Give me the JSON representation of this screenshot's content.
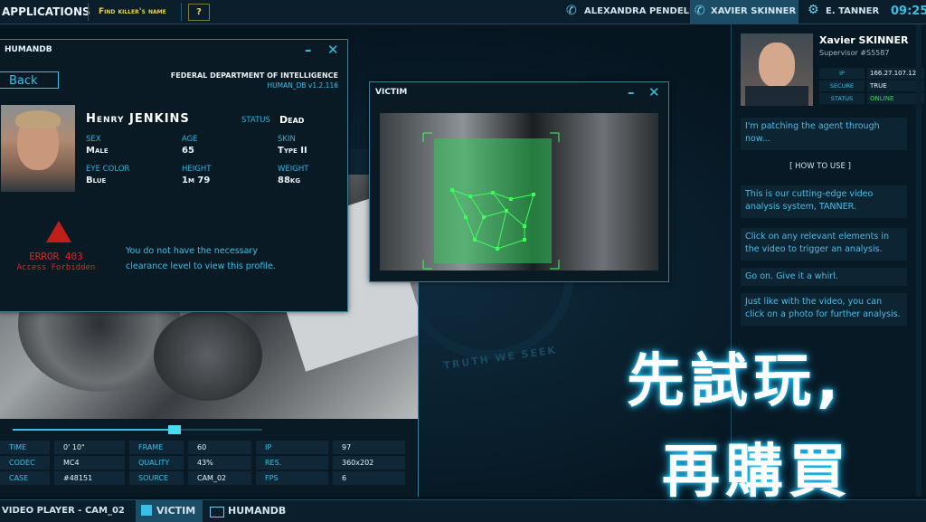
{
  "topbar": {
    "applications": "APPLICATIONS",
    "find_killer": "Find killer's name",
    "help": "?",
    "contact1": "ALEXANDRA PENDELL",
    "contact2": "XAVIER SKINNER",
    "contact3": "E. TANNER",
    "clock": "09:25"
  },
  "humandb": {
    "title": "HUMANDB",
    "back": "Back",
    "dept": "FEDERAL DEPARTMENT OF INTELLIGENCE",
    "version": "HUMAN_DB   v1.2.116",
    "name": "Henry JENKINS",
    "status_label": "STATUS",
    "status_value": "Dead",
    "fields": [
      {
        "label": "SEX",
        "value": "Male"
      },
      {
        "label": "AGE",
        "value": "65"
      },
      {
        "label": "SKIN",
        "value": "Type II"
      },
      {
        "label": "EYE COLOR",
        "value": "Blue"
      },
      {
        "label": "HEIGHT",
        "value": "1m 79"
      },
      {
        "label": "WEIGHT",
        "value": "88kg"
      }
    ],
    "error_code": "ERROR 403",
    "error_text": "Access Forbidden",
    "clearance_line1": "You do not have the necessary",
    "clearance_line2": "clearance level to view this profile."
  },
  "victim": {
    "title": "VICTIM"
  },
  "seal_text": "TRUTH WE SEEK",
  "stats": {
    "rows": [
      [
        {
          "k": "TIME",
          "v": "0' 10\""
        },
        {
          "k": "FRAME",
          "v": "60"
        },
        {
          "k": "IP",
          "v": "97"
        }
      ],
      [
        {
          "k": "CODEC",
          "v": "MC4"
        },
        {
          "k": "QUALITY",
          "v": "43%"
        },
        {
          "k": "RES.",
          "v": "360x202"
        }
      ],
      [
        {
          "k": "CASE",
          "v": "#48151"
        },
        {
          "k": "SOURCE",
          "v": "CAM_02"
        },
        {
          "k": "FPS",
          "v": "6"
        }
      ]
    ],
    "progress": 0.65
  },
  "taskbar": {
    "video_player": "VIDEO PLAYER - CAM_02",
    "victim": "VICTIM",
    "humandb": "HUMANDB"
  },
  "side": {
    "name": "Xavier SKINNER",
    "role": "Supervisor #S5587",
    "info": [
      {
        "k": "IP",
        "v": "166.27.107.12"
      },
      {
        "k": "SECURE",
        "v": "TRUE"
      },
      {
        "k": "STATUS",
        "v": "ONLINE"
      }
    ],
    "messages": [
      "I'm patching the agent through now...",
      "This is our cutting-edge video analysis system, TANNER.",
      "Click on any relevant elements in the video to trigger an analysis.",
      "Go on. Give it a whirl.",
      "Just like with the video, you can click on a photo for further analysis."
    ],
    "how_to_use": "[   HOW TO USE   ]"
  },
  "overlay": {
    "line1": "先試玩,",
    "line2": "再購買"
  },
  "colors": {
    "accent": "#37c0e8",
    "error": "#e0231f",
    "online": "#38d84a"
  }
}
